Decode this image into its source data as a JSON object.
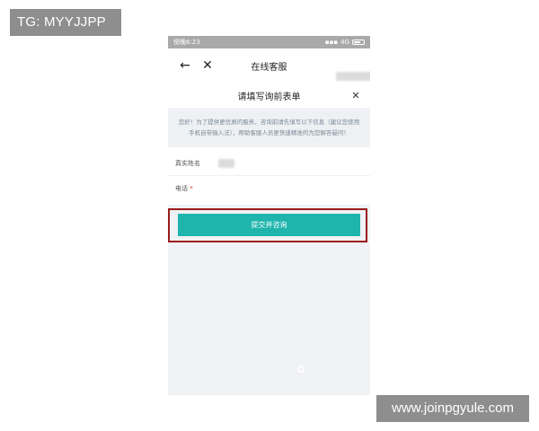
{
  "watermarks": {
    "top": "TG: MYYJJPP",
    "bottom": "www.joinpgyule.com"
  },
  "status_bar": {
    "left": "傍晚6:23",
    "network": "4G"
  },
  "nav": {
    "title": "在线客服"
  },
  "form": {
    "title": "请填写询前表单",
    "notice": "您好！为了提供更优质的服务，咨询前请先填写以下信息（建议您使用手机自带输入法），帮助客服人员更快速精准的为您解答疑问！",
    "fields": [
      {
        "label": "真实姓名",
        "required": false
      },
      {
        "label": "电话",
        "required": true,
        "required_mark": "*"
      }
    ],
    "submit_label": "提交并咨询"
  },
  "icons": {
    "back": "arrow-left-icon",
    "close": "close-icon",
    "form_close": "close-icon"
  },
  "colors": {
    "accent": "#1fb5ad",
    "highlight_border": "#9b1b1b",
    "required": "#e0302b"
  }
}
